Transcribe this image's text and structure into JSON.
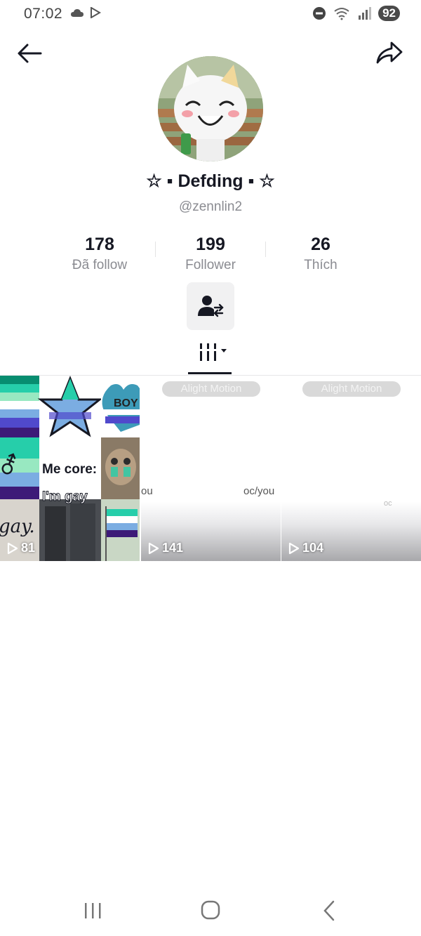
{
  "status_bar": {
    "time": "07:02",
    "battery": "92",
    "icons": [
      "cloud-icon",
      "play-store-icon",
      "dnd-icon",
      "wifi-icon",
      "signal-icon",
      "battery-icon"
    ]
  },
  "profile": {
    "display_name": "☆ ▪ Defding ▪ ☆",
    "username": "@zennlin2"
  },
  "stats": [
    {
      "value": "178",
      "label": "Đã follow"
    },
    {
      "value": "199",
      "label": "Follower"
    },
    {
      "value": "26",
      "label": "Thích"
    }
  ],
  "videos": [
    {
      "views": "81",
      "overlay_text_1": "Me core:",
      "overlay_text_2": "I'm gay",
      "overlay_text_3": "gay.",
      "overlay_text_4": "BOY"
    },
    {
      "views": "141",
      "pill": "Alight Motion",
      "caption": "oc/you",
      "caption_left": "ou"
    },
    {
      "views": "104",
      "pill": "Alight Motion",
      "caption": "oc"
    }
  ],
  "colors": {
    "flag": [
      "#078d70",
      "#26ceaa",
      "#98e8c1",
      "#ffffff",
      "#7bade2",
      "#5049cc",
      "#3d1a78"
    ],
    "text_primary": "#161823",
    "text_secondary": "#8a8b91"
  }
}
